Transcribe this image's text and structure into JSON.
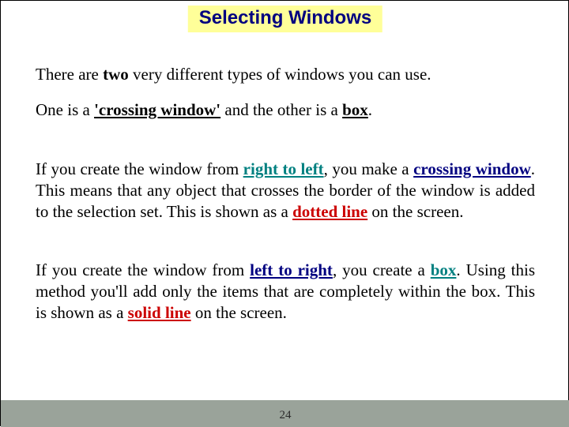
{
  "title": "Selecting Windows",
  "p1": {
    "t1": "There are ",
    "two": "two",
    "t2": " very different types of windows you can use."
  },
  "p2": {
    "t1": "One is a ",
    "cw": "'crossing window'",
    "t2": " and the other is a ",
    "box": "box",
    "t3": "."
  },
  "p3": {
    "t1": "If you create the window from ",
    "rtl": "right to left",
    "t2": ", you make a ",
    "cw": "crossing window",
    "t3": ". This means that any object that crosses the border of the window is added to the selection set. This is shown as a ",
    "dotted": "dotted line",
    "t4": " on the screen."
  },
  "p4": {
    "t1": "If you create the window from ",
    "ltr": "left to right",
    "t2": ", you create a ",
    "box": "box",
    "t3": ". Using this method you'll add only the items that are completely within the box. This is shown as a ",
    "solid": "solid line",
    "t4": " on the screen."
  },
  "page_number": "24"
}
